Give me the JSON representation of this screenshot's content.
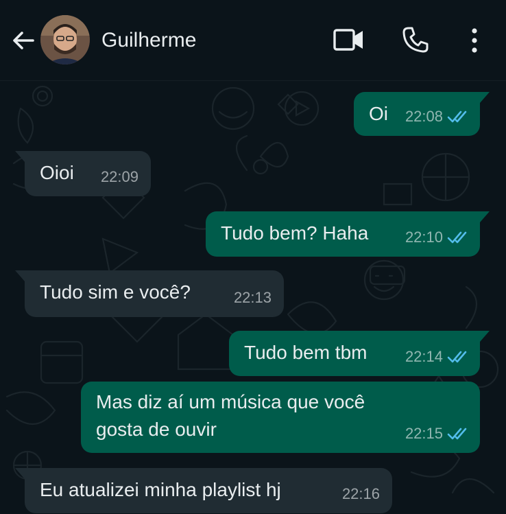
{
  "header": {
    "back_icon": "arrow-left-icon",
    "contact_name": "Guilherme",
    "video_icon": "video-camera-icon",
    "call_icon": "phone-icon",
    "menu_icon": "more-vertical-icon"
  },
  "colors": {
    "background": "#0b141a",
    "outgoing_bubble": "#005c4b",
    "incoming_bubble": "#202c33",
    "read_ticks": "#53bdeb"
  },
  "messages": [
    {
      "direction": "out",
      "text": "Oi",
      "time": "22:08",
      "read": true
    },
    {
      "direction": "in",
      "text": "Oioi",
      "time": "22:09"
    },
    {
      "direction": "out",
      "text": "Tudo bem? Haha",
      "time": "22:10",
      "read": true
    },
    {
      "direction": "in",
      "text": "Tudo sim e você?",
      "time": "22:13"
    },
    {
      "direction": "out",
      "text": "Tudo bem tbm",
      "time": "22:14",
      "read": true
    },
    {
      "direction": "out",
      "text_lines": [
        "Mas diz aí um música que você",
        "gosta de ouvir"
      ],
      "time": "22:15",
      "read": true
    },
    {
      "direction": "in",
      "text": "Eu atualizei minha playlist hj",
      "time": "22:16"
    }
  ]
}
